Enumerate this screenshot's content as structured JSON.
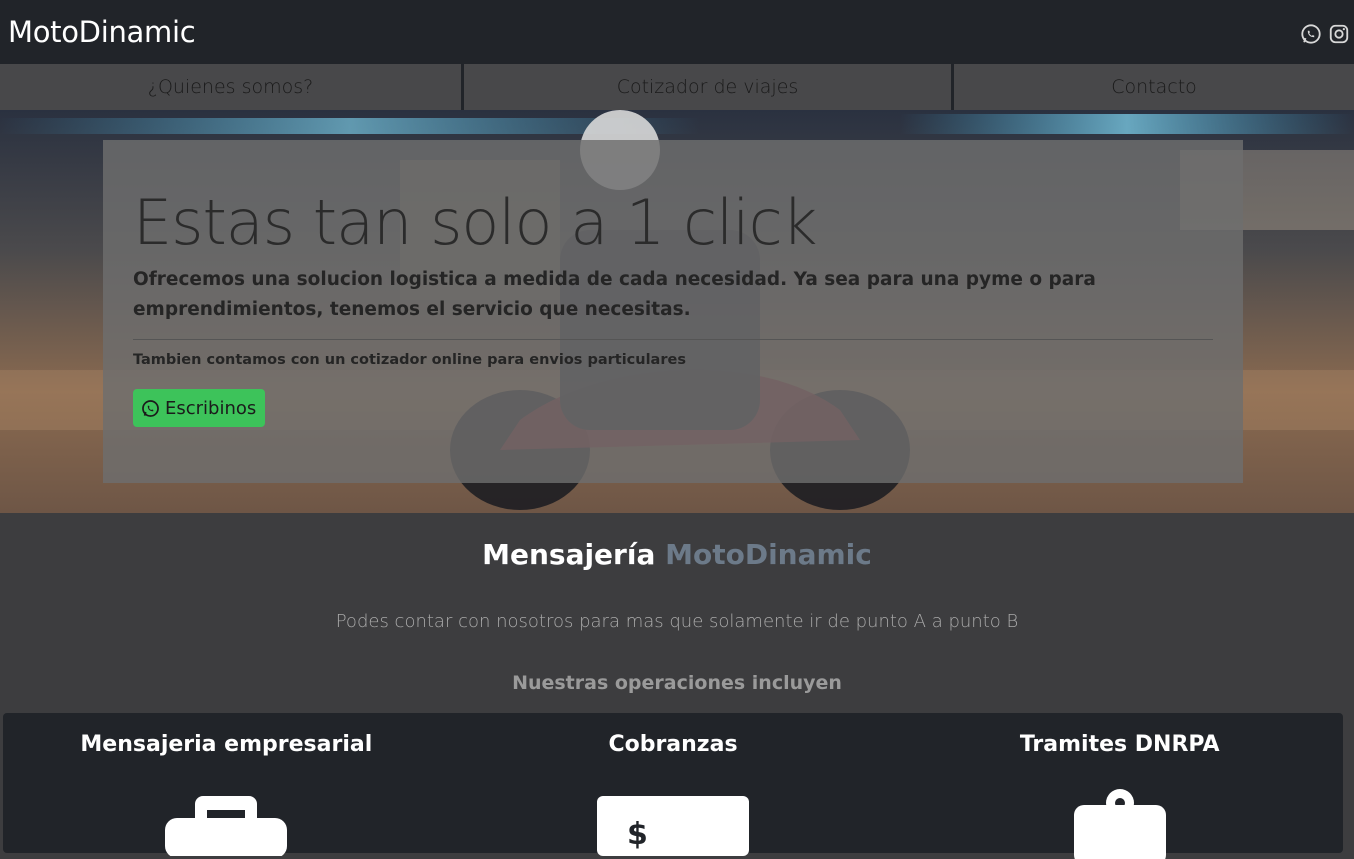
{
  "header": {
    "brand": "MotoDinamic",
    "social": [
      {
        "icon": "whatsapp-icon"
      },
      {
        "icon": "instagram-icon"
      }
    ]
  },
  "nav": {
    "items": [
      {
        "label": "¿Quienes somos?"
      },
      {
        "label": "Cotizador de viajes"
      },
      {
        "label": "Contacto"
      }
    ]
  },
  "hero": {
    "title": "Estas tan solo a 1 click",
    "lead": "Ofrecemos una solucion logistica a medida de cada necesidad. Ya sea para una pyme o para emprendimientos, tenemos el servicio que necesitas.",
    "small": "Tambien contamos con un cotizador online para envios particulares",
    "button": {
      "label": "Escribinos",
      "icon": "whatsapp-icon",
      "color": "#3dc35a"
    }
  },
  "section": {
    "title_main": "Mensajería",
    "title_accent": "MotoDinamic",
    "subtitle": "Podes contar con nosotros para mas que solamente ir de punto A a punto B",
    "operations_heading": "Nuestras operaciones incluyen",
    "cards": [
      {
        "title": "Mensajeria empresarial",
        "icon": "briefcase-icon"
      },
      {
        "title": "Cobranzas",
        "icon": "money-bill-icon"
      },
      {
        "title": "Tramites DNRPA",
        "icon": "id-badge-icon"
      }
    ]
  },
  "colors": {
    "topbar": "#212429",
    "nav": "#48484a",
    "page": "#3d3d3f",
    "accent": "#6c7a89",
    "whatsapp_green": "#3dc35a"
  }
}
